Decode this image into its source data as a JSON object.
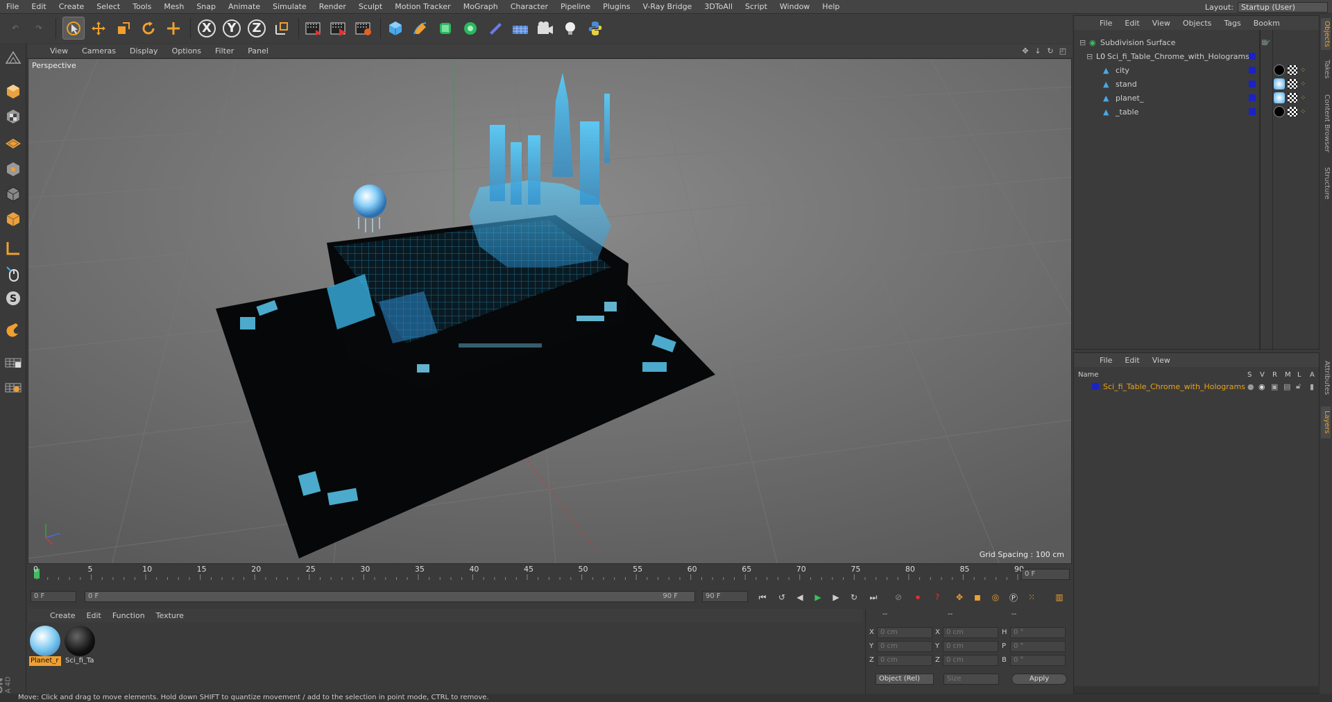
{
  "menubar": {
    "items": [
      "File",
      "Edit",
      "Create",
      "Select",
      "Tools",
      "Mesh",
      "Snap",
      "Animate",
      "Simulate",
      "Render",
      "Sculpt",
      "Motion Tracker",
      "MoGraph",
      "Character",
      "Pipeline",
      "Plugins",
      "V-Ray Bridge",
      "3DToAll",
      "Script",
      "Window",
      "Help"
    ],
    "layout_label": "Layout:",
    "layout_value": "Startup (User)"
  },
  "toolbar": {
    "axis_x": "X",
    "axis_y": "Y",
    "axis_z": "Z"
  },
  "viewport": {
    "menu": [
      "View",
      "Cameras",
      "Display",
      "Options",
      "Filter",
      "Panel"
    ],
    "label": "Perspective",
    "grid_spacing": "Grid Spacing : 100 cm"
  },
  "timeline": {
    "ticks": [
      "0",
      "5",
      "10",
      "15",
      "20",
      "25",
      "30",
      "35",
      "40",
      "45",
      "50",
      "55",
      "60",
      "65",
      "70",
      "75",
      "80",
      "85",
      "90"
    ],
    "current_frame": "0 F",
    "start_field": "0 F",
    "range_start": "0 F",
    "range_end": "90 F",
    "end_field": "90 F"
  },
  "materials": {
    "menu": [
      "Create",
      "Edit",
      "Function",
      "Texture"
    ],
    "items": [
      {
        "label": "Planet_r",
        "color": "#2a6db0"
      },
      {
        "label": "Sci_fi_Ta",
        "color": "#111111"
      }
    ]
  },
  "coordinates": {
    "header_a": "--",
    "header_b": "--",
    "header_c": "--",
    "rows": [
      {
        "a": "X",
        "av": "0 cm",
        "b": "X",
        "bv": "0 cm",
        "c": "H",
        "cv": "0 °"
      },
      {
        "a": "Y",
        "av": "0 cm",
        "b": "Y",
        "bv": "0 cm",
        "c": "P",
        "cv": "0 °"
      },
      {
        "a": "Z",
        "av": "0 cm",
        "b": "Z",
        "bv": "0 cm",
        "c": "B",
        "cv": "0 °"
      }
    ],
    "mode": "Object (Rel)",
    "size_mode": "Size",
    "apply": "Apply"
  },
  "objects": {
    "menu": [
      "File",
      "Edit",
      "View",
      "Objects",
      "Tags",
      "Bookm"
    ],
    "tree": [
      {
        "name": "Subdivision Surface",
        "level": 0
      },
      {
        "name": "Sci_fi_Table_Chrome_with_Holograms",
        "level": 1
      },
      {
        "name": "city",
        "level": 2
      },
      {
        "name": "stand",
        "level": 2
      },
      {
        "name": "planet_",
        "level": 2
      },
      {
        "name": "_table",
        "level": 2
      }
    ]
  },
  "layers": {
    "menu": [
      "File",
      "Edit",
      "View"
    ],
    "header": {
      "name": "Name",
      "s": "S",
      "v": "V",
      "r": "R",
      "m": "M",
      "l": "L",
      "a": "A"
    },
    "items": [
      {
        "name": "Sci_fi_Table_Chrome_with_Holograms",
        "color": "#e8a21c"
      }
    ]
  },
  "side_tabs": [
    "Objects",
    "Takes",
    "Content Browser",
    "Structure",
    "Attributes",
    "Layers"
  ],
  "status": "Move: Click and drag to move elements. Hold down SHIFT to quantize movement / add to the selection in point mode, CTRL to remove.",
  "colors": {
    "accent": "#f0a030",
    "hologram": "#3ab8e8",
    "layer_blue": "#1a22c8"
  }
}
